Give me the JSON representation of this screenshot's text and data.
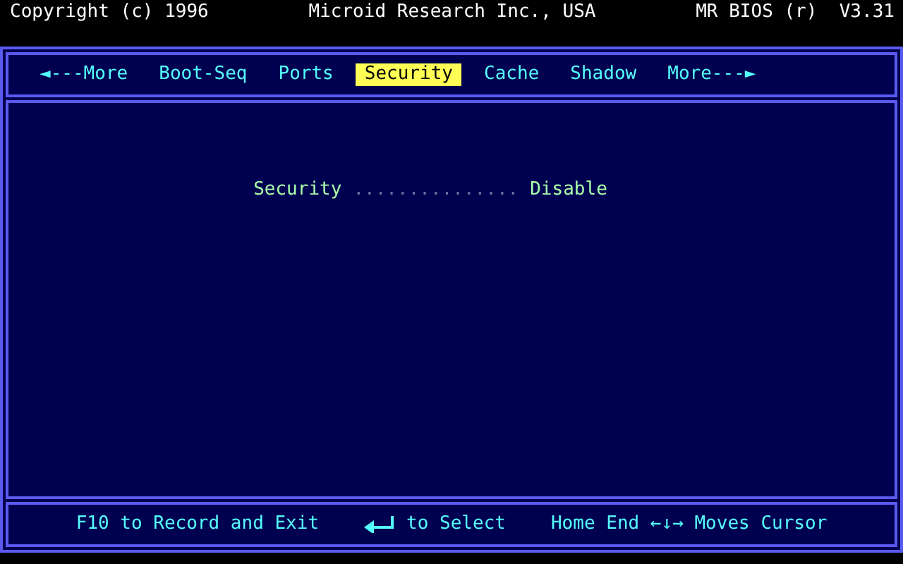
{
  "header": {
    "copyright": "Copyright (c) 1996",
    "company": "Microid Research Inc., USA",
    "version": "MR BIOS (r)  V3.31"
  },
  "menu": [
    {
      "label": "◄---More",
      "selected": false
    },
    {
      "label": "Boot-Seq",
      "selected": false
    },
    {
      "label": "Ports",
      "selected": false
    },
    {
      "label": "Security",
      "selected": true
    },
    {
      "label": "Cache",
      "selected": false
    },
    {
      "label": "Shadow",
      "selected": false
    },
    {
      "label": "More---►",
      "selected": false
    }
  ],
  "settings": [
    {
      "label": "Security",
      "leader": "...............",
      "value": "Disable"
    }
  ],
  "footer": [
    {
      "kind": "text",
      "text": "F10 to Record and Exit"
    },
    {
      "kind": "enter",
      "text": "to Select"
    },
    {
      "kind": "text",
      "text": "Home End ←↓→ Moves Cursor"
    }
  ]
}
